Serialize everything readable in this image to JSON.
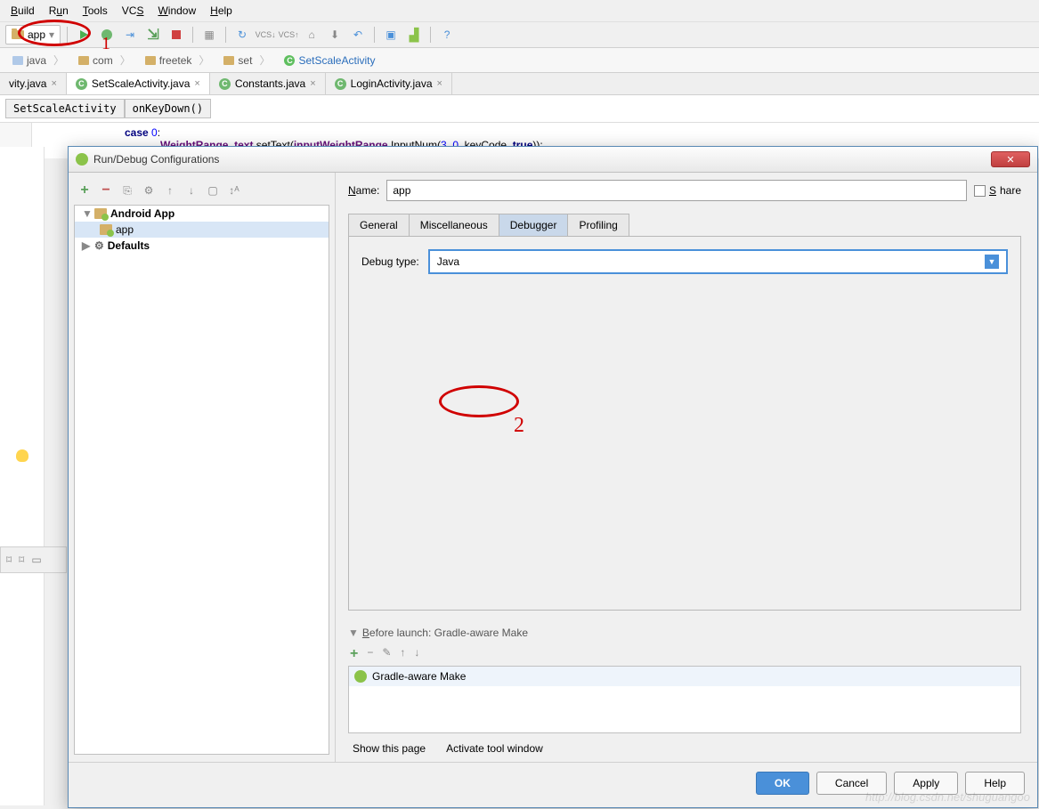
{
  "menu": {
    "build": "Build",
    "run": "Run",
    "tools": "Tools",
    "vcs": "VCS",
    "window": "Window",
    "help": "Help"
  },
  "run_config_selector": "app",
  "annotations": {
    "one": "1",
    "two": "2"
  },
  "breadcrumb": {
    "b0": "java",
    "b1": "com",
    "b2": "freetek",
    "b3": "set",
    "b4": "SetScaleActivity"
  },
  "tabs": {
    "t0": "vity.java",
    "t1": "SetScaleActivity.java",
    "t2": "Constants.java",
    "t3": "LoginActivity.java"
  },
  "code_header": {
    "cls": "SetScaleActivity",
    "method": "onKeyDown()"
  },
  "code": {
    "line1_a": "case ",
    "line1_b": "0",
    "line1_c": ":",
    "line2_a": "    ",
    "line2_field": "WeightRange_text",
    "line2_b": ".setText(",
    "line2_c": "inputWeightRange",
    "line2_d": ".InputNum(",
    "line2_n1": "3",
    "line2_e": ", ",
    "line2_n2": "0",
    "line2_f": ", keyCode, ",
    "line2_kw": "true",
    "line2_g": "));"
  },
  "dialog": {
    "title": "Run/Debug Configurations",
    "name_label": "Name:",
    "name_value": "app",
    "share": "Share",
    "tree": {
      "android_app": "Android App",
      "app": "app",
      "defaults": "Defaults"
    },
    "cfg_tabs": {
      "general": "General",
      "misc": "Miscellaneous",
      "debugger": "Debugger",
      "profiling": "Profiling"
    },
    "debug_type_label": "Debug type:",
    "debug_type_value": "Java",
    "before_launch_title": "Before launch: Gradle-aware Make",
    "before_launch_item": "Gradle-aware Make",
    "show_this_page": "Show this page",
    "activate_tool_window": "Activate tool window",
    "buttons": {
      "ok": "OK",
      "cancel": "Cancel",
      "apply": "Apply",
      "help": "Help"
    }
  },
  "watermark": "http://blog.csdn.net/shuguangoo"
}
